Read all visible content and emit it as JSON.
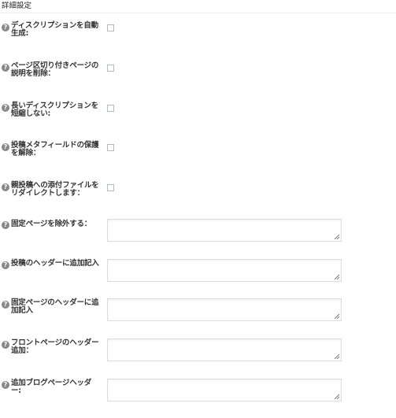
{
  "section": {
    "title": "詳細設定"
  },
  "help_icon_glyph": "?",
  "options": [
    {
      "label": "ディスクリプションを自動生成:",
      "control": "checkbox",
      "checked": false
    },
    {
      "label": "ページ区切り付きページの説明を削除：",
      "control": "checkbox",
      "checked": false
    },
    {
      "label": "長いディスクリプションを短縮しない:",
      "control": "checkbox",
      "checked": false
    },
    {
      "label": "投稿メタフィールドの保護を解除：",
      "control": "checkbox",
      "checked": false
    },
    {
      "label": "親投稿への添付ファイルをリダイレクトします：",
      "control": "checkbox",
      "checked": false
    },
    {
      "label": "固定ページを除外する：",
      "control": "textarea",
      "value": ""
    },
    {
      "label": "投稿のヘッダーに追加記入",
      "control": "textarea",
      "value": ""
    },
    {
      "label": "固定ページのヘッダーに追加記入",
      "control": "textarea",
      "value": ""
    },
    {
      "label": "フロントページのヘッダー追加：",
      "control": "textarea",
      "value": ""
    },
    {
      "label": "追加ブログページヘッダー:",
      "control": "textarea",
      "value": ""
    }
  ]
}
